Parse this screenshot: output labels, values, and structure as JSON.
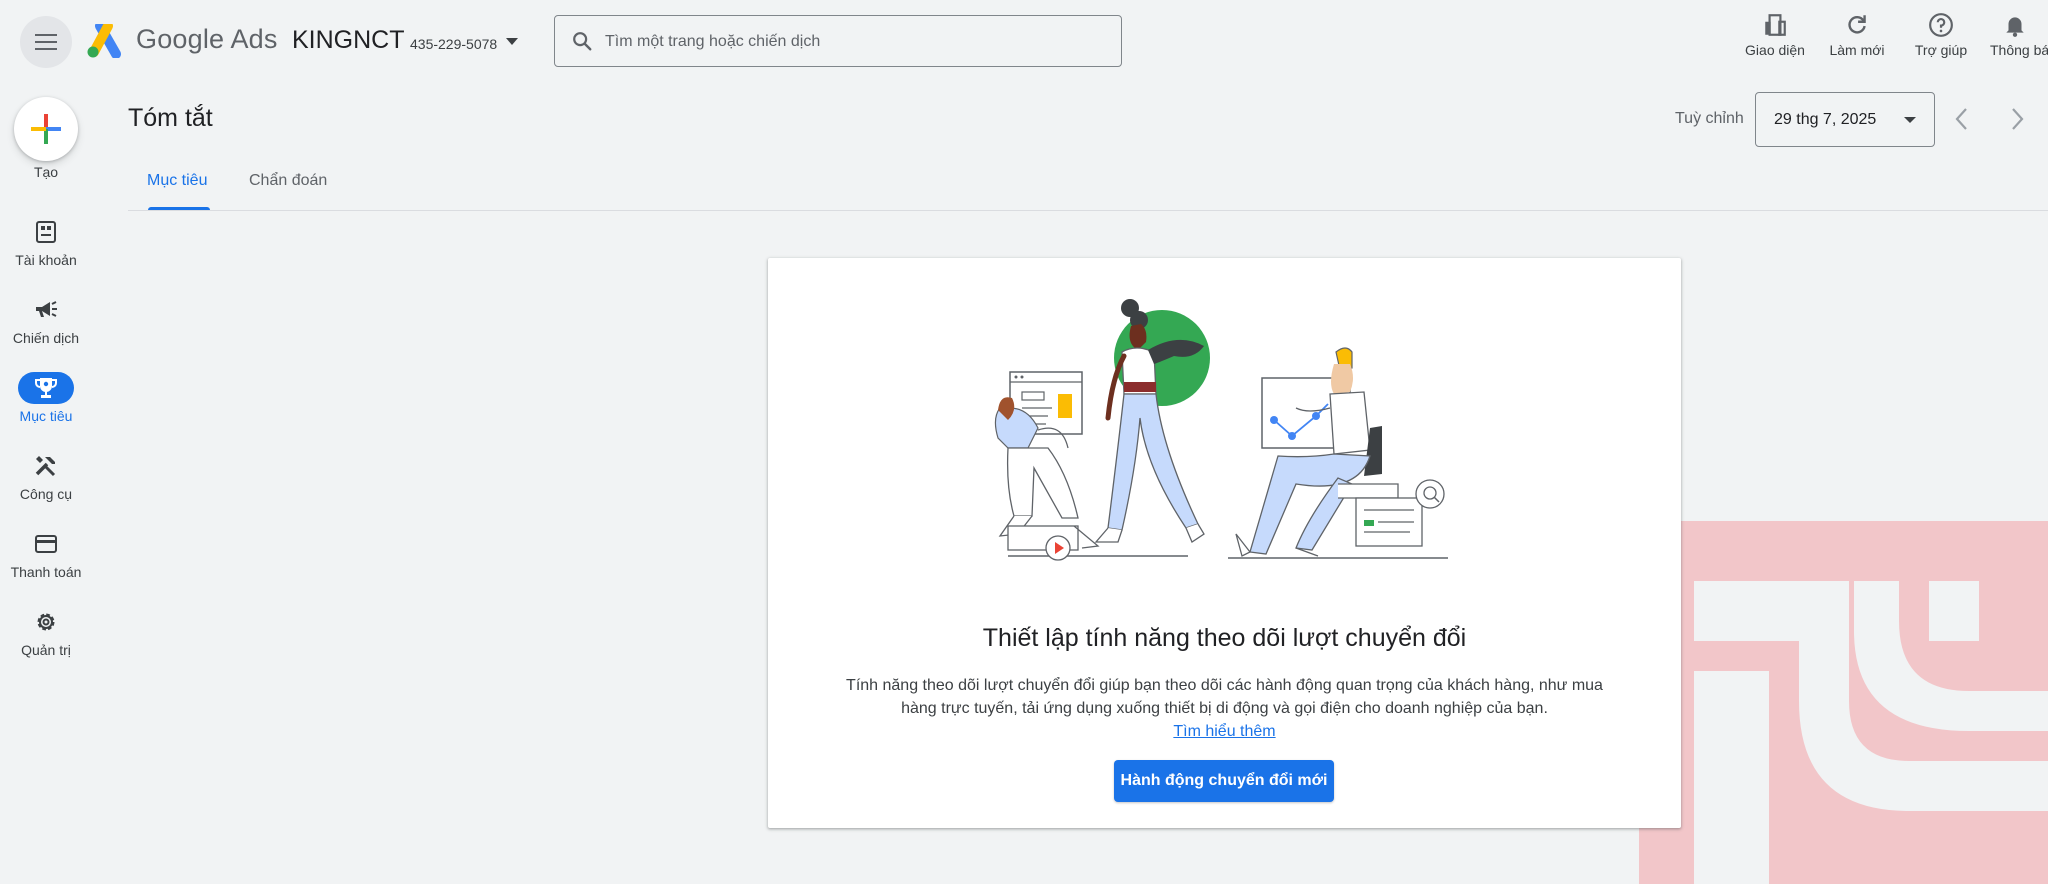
{
  "header": {
    "brand": "Google Ads",
    "account_name": "KINGNCT",
    "account_id": "435-229-5078",
    "search_placeholder": "Tìm một trang hoặc chiến dịch",
    "actions": [
      {
        "label": "Giao diện",
        "icon": "appearance-icon"
      },
      {
        "label": "Làm mới",
        "icon": "refresh-icon"
      },
      {
        "label": "Trợ giúp",
        "icon": "help-icon"
      },
      {
        "label": "Thông bá",
        "icon": "bell-icon"
      }
    ]
  },
  "sidebar": {
    "create_label": "Tạo",
    "items": [
      {
        "label": "Tài khoản",
        "icon": "account-icon"
      },
      {
        "label": "Chiến dịch",
        "icon": "campaign-icon"
      },
      {
        "label": "Mục tiêu",
        "icon": "trophy-icon",
        "active": true
      },
      {
        "label": "Công cụ",
        "icon": "tools-icon"
      },
      {
        "label": "Thanh toán",
        "icon": "billing-icon"
      },
      {
        "label": "Quản trị",
        "icon": "gear-icon"
      }
    ]
  },
  "page": {
    "title": "Tóm tắt",
    "customize_label": "Tuỳ chỉnh",
    "date": "29 thg 7, 2025",
    "tabs": [
      {
        "label": "Mục tiêu",
        "active": true
      },
      {
        "label": "Chẩn đoán",
        "active": false
      }
    ]
  },
  "card": {
    "title": "Thiết lập tính năng theo dõi lượt chuyển đổi",
    "description": "Tính năng theo dõi lượt chuyển đổi giúp bạn theo dõi các hành động quan trọng của khách hàng, như mua hàng trực tuyến, tải ứng dụng xuống thiết bị di động và gọi điện cho doanh nghiệp của bạn.",
    "link": "Tìm hiểu thêm",
    "button": "Hành động chuyển đổi mới"
  },
  "colors": {
    "accent": "#1a73e8",
    "background": "#f1f3f4",
    "watermark": "#f2c6c9"
  }
}
